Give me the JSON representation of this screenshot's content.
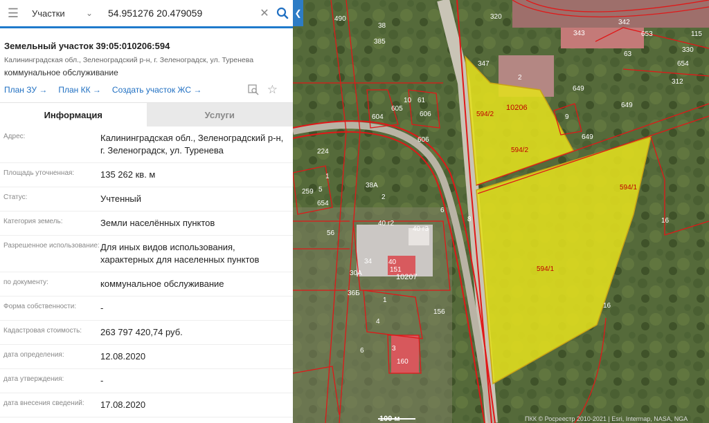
{
  "search": {
    "type_label": "Участки",
    "value": "54.951276 20.479059"
  },
  "parcel": {
    "title": "Земельный участок 39:05:010206:594",
    "address": "Калининградская обл., Зеленоградский р-н, г. Зеленоградск, ул. Туренева",
    "use": "коммунальное обслуживание",
    "links": [
      "План ЗУ →",
      "План КК →",
      "Создать участок ЖС →"
    ]
  },
  "tabs": [
    "Информация",
    "Услуги"
  ],
  "info": [
    {
      "label": "Адрес:",
      "value": "Калининградская обл., Зеленоградский р-н, г. Зеленоградск, ул. Туренева"
    },
    {
      "label": "Площадь уточненная:",
      "value": "135 262 кв. м"
    },
    {
      "label": "Статус:",
      "value": "Учтенный"
    },
    {
      "label": "Категория земель:",
      "value": "Земли населённых пунктов"
    },
    {
      "label": "Разрешенное использование:",
      "value": "Для иных видов использования, характерных для населенных пунктов"
    },
    {
      "label": "по документу:",
      "value": "коммунальное обслуживание"
    },
    {
      "label": "Форма собственности:",
      "value": "-"
    },
    {
      "label": "Кадастровая стоимость:",
      "value": "263 797 420,74 руб."
    },
    {
      "label": "дата определения:",
      "value": "12.08.2020"
    },
    {
      "label": "дата утверждения:",
      "value": "-"
    },
    {
      "label": "дата внесения сведений:",
      "value": "17.08.2020"
    }
  ],
  "map": {
    "scale_label": "100 м",
    "attribution": "ПКК © Росреестр 2010-2021 | Esri, Intermap, NASA, NGA",
    "parcel_labels": [
      "594/1",
      "594/1",
      "594/2",
      "594/2",
      "10206",
      "10207"
    ],
    "plot_numbers": [
      "320",
      "343",
      "342",
      "653",
      "63",
      "330",
      "654",
      "115",
      "312",
      "347",
      "2",
      "649",
      "649",
      "649",
      "9",
      "490",
      "38",
      "385",
      "604",
      "605",
      "10",
      "61",
      "606",
      "606",
      "224",
      "259",
      "1",
      "5",
      "654",
      "38А",
      "2",
      "6",
      "8",
      "40 г2",
      "40 г3",
      "34",
      "40",
      "151",
      "30А",
      "36Б",
      "1",
      "4",
      "156",
      "3",
      "160",
      "16",
      "16",
      "56",
      "6"
    ],
    "colors": {
      "highlight": "#e2df1e",
      "boundary": "#e01818",
      "road": "#c7c2b4"
    }
  }
}
